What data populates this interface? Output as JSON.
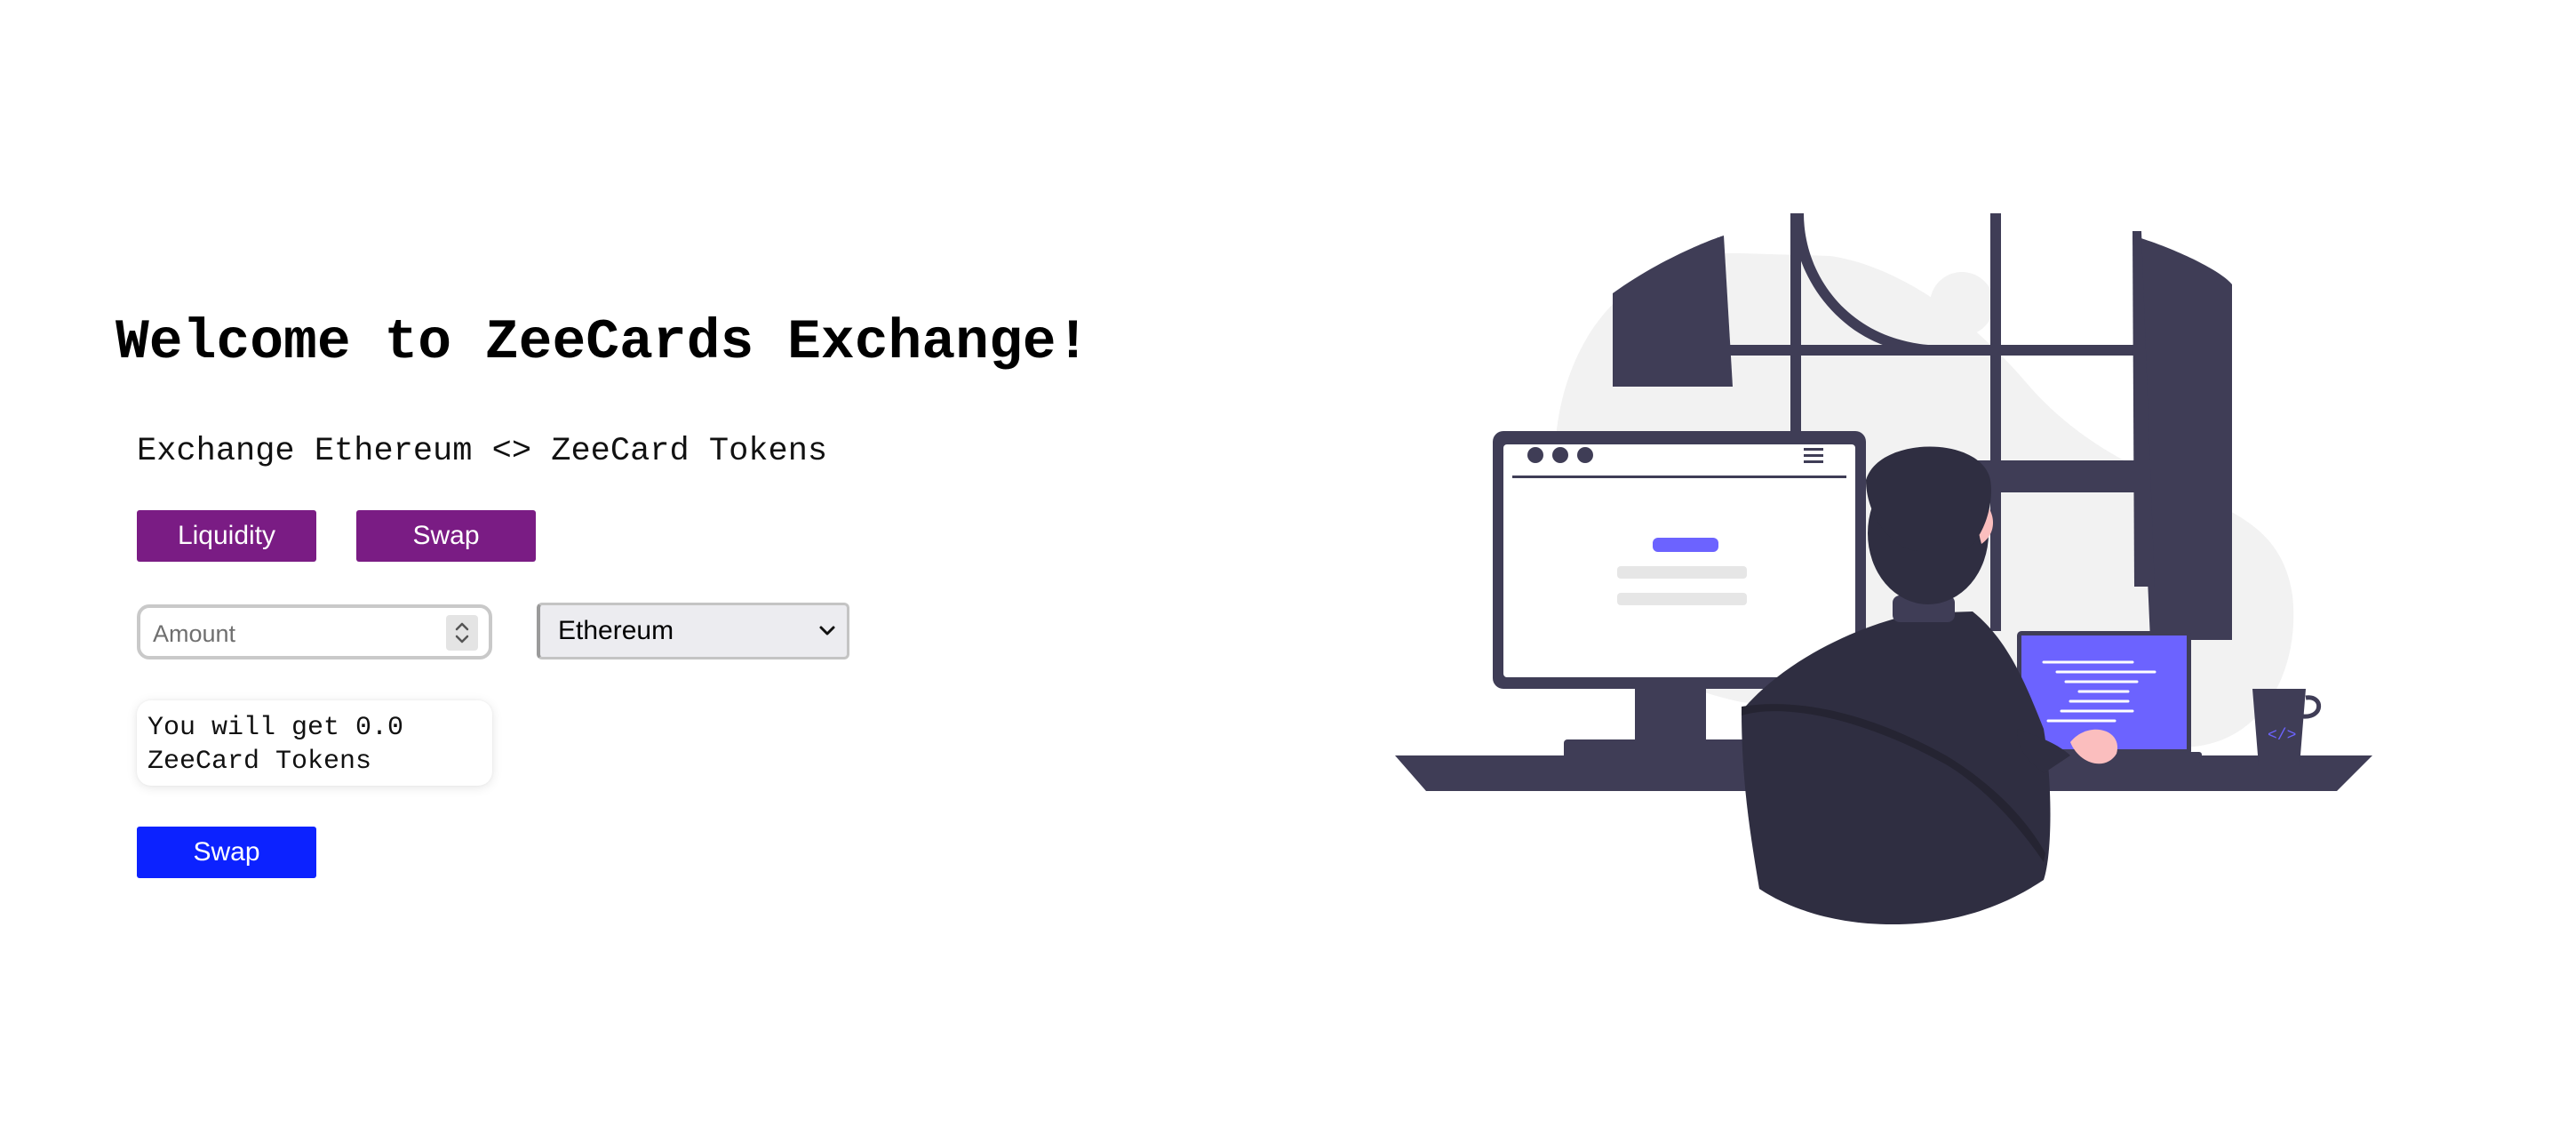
{
  "page": {
    "title": "Welcome to ZeeCards Exchange!",
    "subtitle": "Exchange Ethereum <> ZeeCard Tokens"
  },
  "tabs": {
    "liquidity_label": "Liquidity",
    "swap_label": "Swap"
  },
  "form": {
    "amount_placeholder": "Amount",
    "amount_value": "",
    "token_select": {
      "selected": "Ethereum"
    },
    "result_text": "You will get 0.0 ZeeCard Tokens",
    "submit_label": "Swap"
  },
  "colors": {
    "tab_button": "#7a1c84",
    "primary_button": "#0c22ff",
    "illustration_dark": "#3f3d56",
    "illustration_accent": "#6c63ff"
  },
  "icons": {
    "stepper": "up-down-chevron-icon",
    "select_arrow": "chevron-down-icon",
    "illustration": "developer-at-desk-illustration"
  }
}
